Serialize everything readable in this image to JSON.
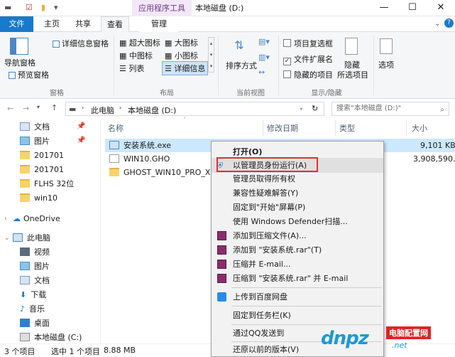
{
  "window": {
    "title": "本地磁盘 (D:)",
    "context_tab_group": "应用程序工具",
    "minimize": "—",
    "maximize": "☐",
    "close": "✕"
  },
  "tabs": {
    "file": "文件",
    "home": "主页",
    "share": "共享",
    "view": "查看",
    "manage": "管理"
  },
  "ribbon": {
    "pane": {
      "nav_pane": "导航窗格",
      "preview_pane": "预览窗格",
      "details_pane": "详细信息窗格",
      "label": "窗格"
    },
    "layout": {
      "xlarge": "超大图标",
      "large": "大图标",
      "medium": "中图标",
      "small": "小图标",
      "list": "列表",
      "details": "详细信息",
      "label": "布局"
    },
    "current_view": {
      "sort": "排序方式",
      "label": "当前视图"
    },
    "show_hide": {
      "item_checkbox": "项目复选框",
      "file_ext": "文件扩展名",
      "hidden_items": "隐藏的项目",
      "hide_selected": "隐藏",
      "hide_selected2": "所选项目",
      "label": "显示/隐藏"
    },
    "options": "选项"
  },
  "address": {
    "crumb1": "此电脑",
    "crumb2": "本地磁盘 (D:)",
    "search_placeholder": "搜索\"本地磁盘 (D:)\""
  },
  "nav": {
    "items": [
      "文档",
      "图片",
      "201701",
      "201701",
      "FLHS 32位",
      "win10",
      "OneDrive",
      "此电脑",
      "视频",
      "图片",
      "文档",
      "下载",
      "音乐",
      "桌面",
      "本地磁盘 (C:)"
    ]
  },
  "columns": {
    "name": "名称",
    "date": "修改日期",
    "type": "类型",
    "size": "大小"
  },
  "files": [
    {
      "name": "安装系统.exe",
      "size": "9,101 KB"
    },
    {
      "name": "WIN10.GHO",
      "size": "3,908,590..."
    },
    {
      "name": "GHOST_WIN10_PRO_X64_",
      "size": ""
    }
  ],
  "status": {
    "count": "3 个项目",
    "selected": "选中 1 个项目",
    "size": "8.88 MB"
  },
  "context_menu": {
    "items": [
      "打开(O)",
      "以管理员身份运行(A)",
      "管理员取得所有权",
      "兼容性疑难解答(Y)",
      "固定到\"开始\"屏幕(P)",
      "使用 Windows Defender扫描...",
      "添加到压缩文件(A)...",
      "添加到 \"安装系统.rar\"(T)",
      "压缩并 E-mail...",
      "压缩到 \"安装系统.rar\" 并 E-mail",
      "上传到百度网盘",
      "固定到任务栏(K)",
      "通过QQ发送到",
      "还原以前的版本(V)"
    ]
  },
  "watermark": {
    "brand": "dnpz",
    "suffix": ".net",
    "cn": "电脑配置网"
  },
  "colors": {
    "accent": "#1979ca",
    "highlight_border": "#e03030",
    "selection": "#cce8ff"
  }
}
